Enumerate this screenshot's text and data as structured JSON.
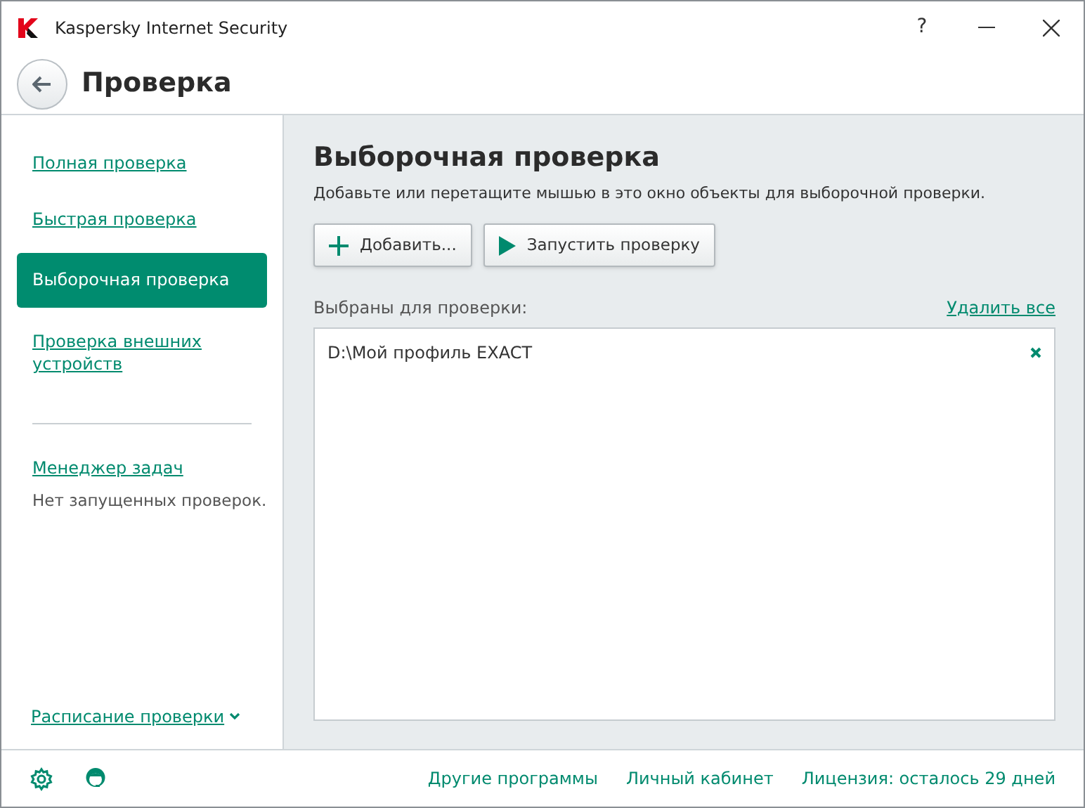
{
  "window": {
    "title": "Kaspersky Internet Security",
    "help": "?"
  },
  "header": {
    "title": "Проверка"
  },
  "sidebar": {
    "items": [
      {
        "label": "Полная проверка",
        "selected": false
      },
      {
        "label": "Быстрая проверка",
        "selected": false
      },
      {
        "label": "Выборочная проверка",
        "selected": true
      },
      {
        "label": "Проверка внешних устройств",
        "selected": false
      }
    ],
    "task_manager": {
      "link": "Менеджер задач",
      "status": "Нет запущенных проверок."
    },
    "schedule": "Расписание проверки"
  },
  "content": {
    "title": "Выборочная проверка",
    "subtitle": "Добавьте или перетащите мышью в это окно объекты для выборочной проверки.",
    "buttons": [
      {
        "kind": "add",
        "label": "Добавить..."
      },
      {
        "kind": "run",
        "label": "Запустить проверку"
      }
    ],
    "list_label": "Выбраны для проверки:",
    "clear_link": "Удалить все",
    "objects": [
      "D:\\Мой профиль EXACT"
    ]
  },
  "footer": {
    "links": [
      "Другие программы",
      "Личный кабинет",
      "Лицензия: осталось 29 дней"
    ]
  }
}
